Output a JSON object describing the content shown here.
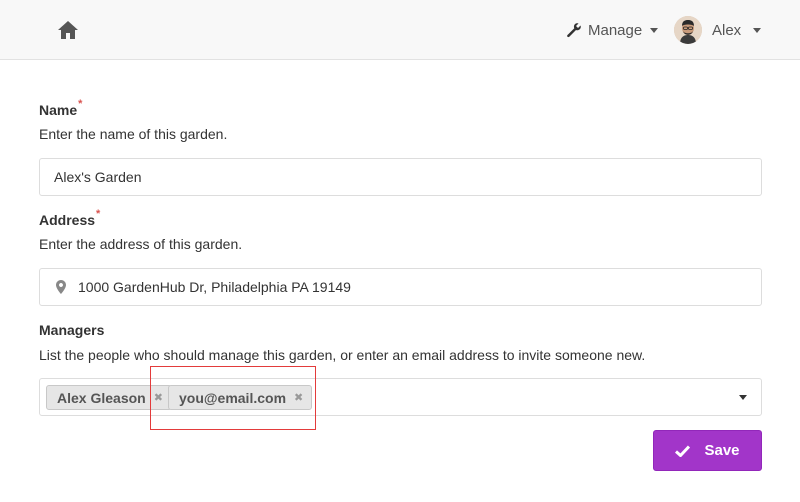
{
  "navbar": {
    "home_icon": "home-icon",
    "manage_label": "Manage",
    "manage_icon": "wrench-icon",
    "user_name": "Alex"
  },
  "form": {
    "name": {
      "label": "Name",
      "required_mark": "*",
      "help": "Enter the name of this garden.",
      "value": "Alex's Garden"
    },
    "address": {
      "label": "Address",
      "required_mark": "*",
      "help": "Enter the address of this garden.",
      "value": "1000 GardenHub Dr, Philadelphia PA 19149",
      "icon": "map-pin-icon"
    },
    "managers": {
      "label": "Managers",
      "help": "List the people who should manage this garden, or enter an email address to invite someone new.",
      "tags": [
        {
          "label": "Alex Gleason",
          "remove": "✖"
        },
        {
          "label": "you@email.com",
          "remove": "✖"
        }
      ]
    },
    "save_label": "Save"
  },
  "colors": {
    "accent": "#a235c9",
    "highlight": "#e33b3b"
  }
}
